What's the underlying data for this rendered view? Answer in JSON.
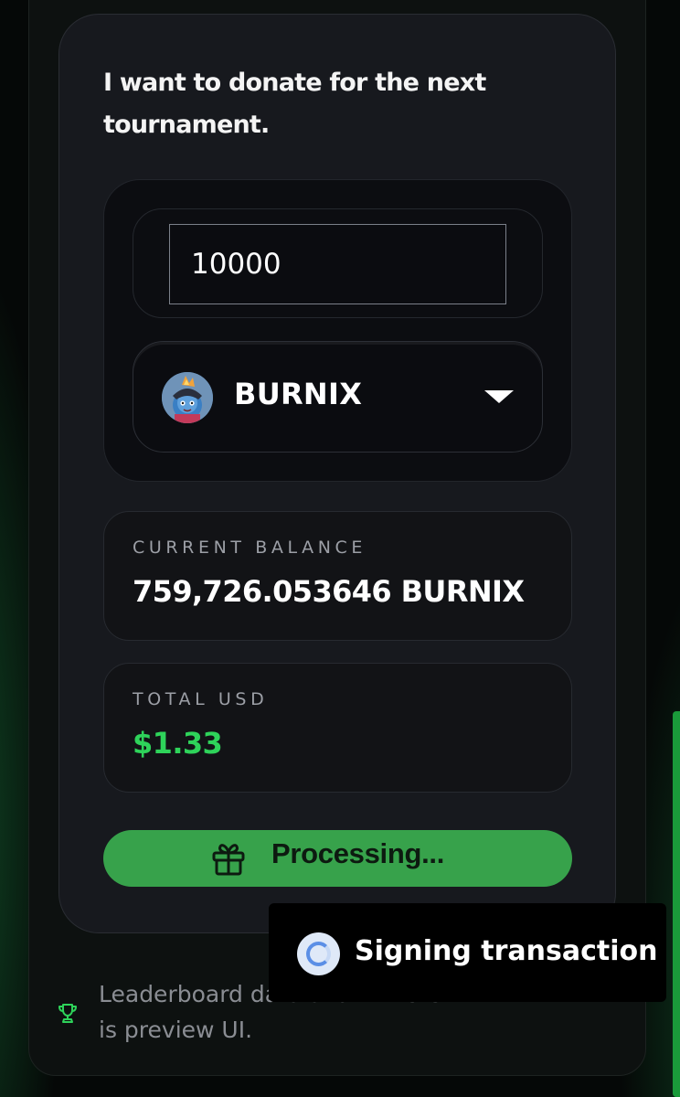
{
  "donation_card": {
    "heading": "I want to donate for the next tournament.",
    "amount_input": {
      "value": "10000"
    },
    "token_select": {
      "selected": "BURNIX",
      "avatar_icon": "burnix-token-avatar",
      "dropdown_icon": "caret-down-icon"
    },
    "balance": {
      "label": "CURRENT BALANCE",
      "value": "759,726.053646 BURNIX"
    },
    "total_usd": {
      "label": "TOTAL USD",
      "value": "$1.33",
      "color": "#2ed35a"
    },
    "submit_button": {
      "label": "Processing...",
      "icon": "gift-icon",
      "color": "#37a24b"
    }
  },
  "footer": {
    "icon": "trophy-icon",
    "note": "Leaderboard data shown here is preview UI."
  },
  "toast": {
    "icon": "spinner-icon",
    "text": "Signing transaction"
  },
  "scrollbar": {
    "color": "#1a9a3a"
  }
}
